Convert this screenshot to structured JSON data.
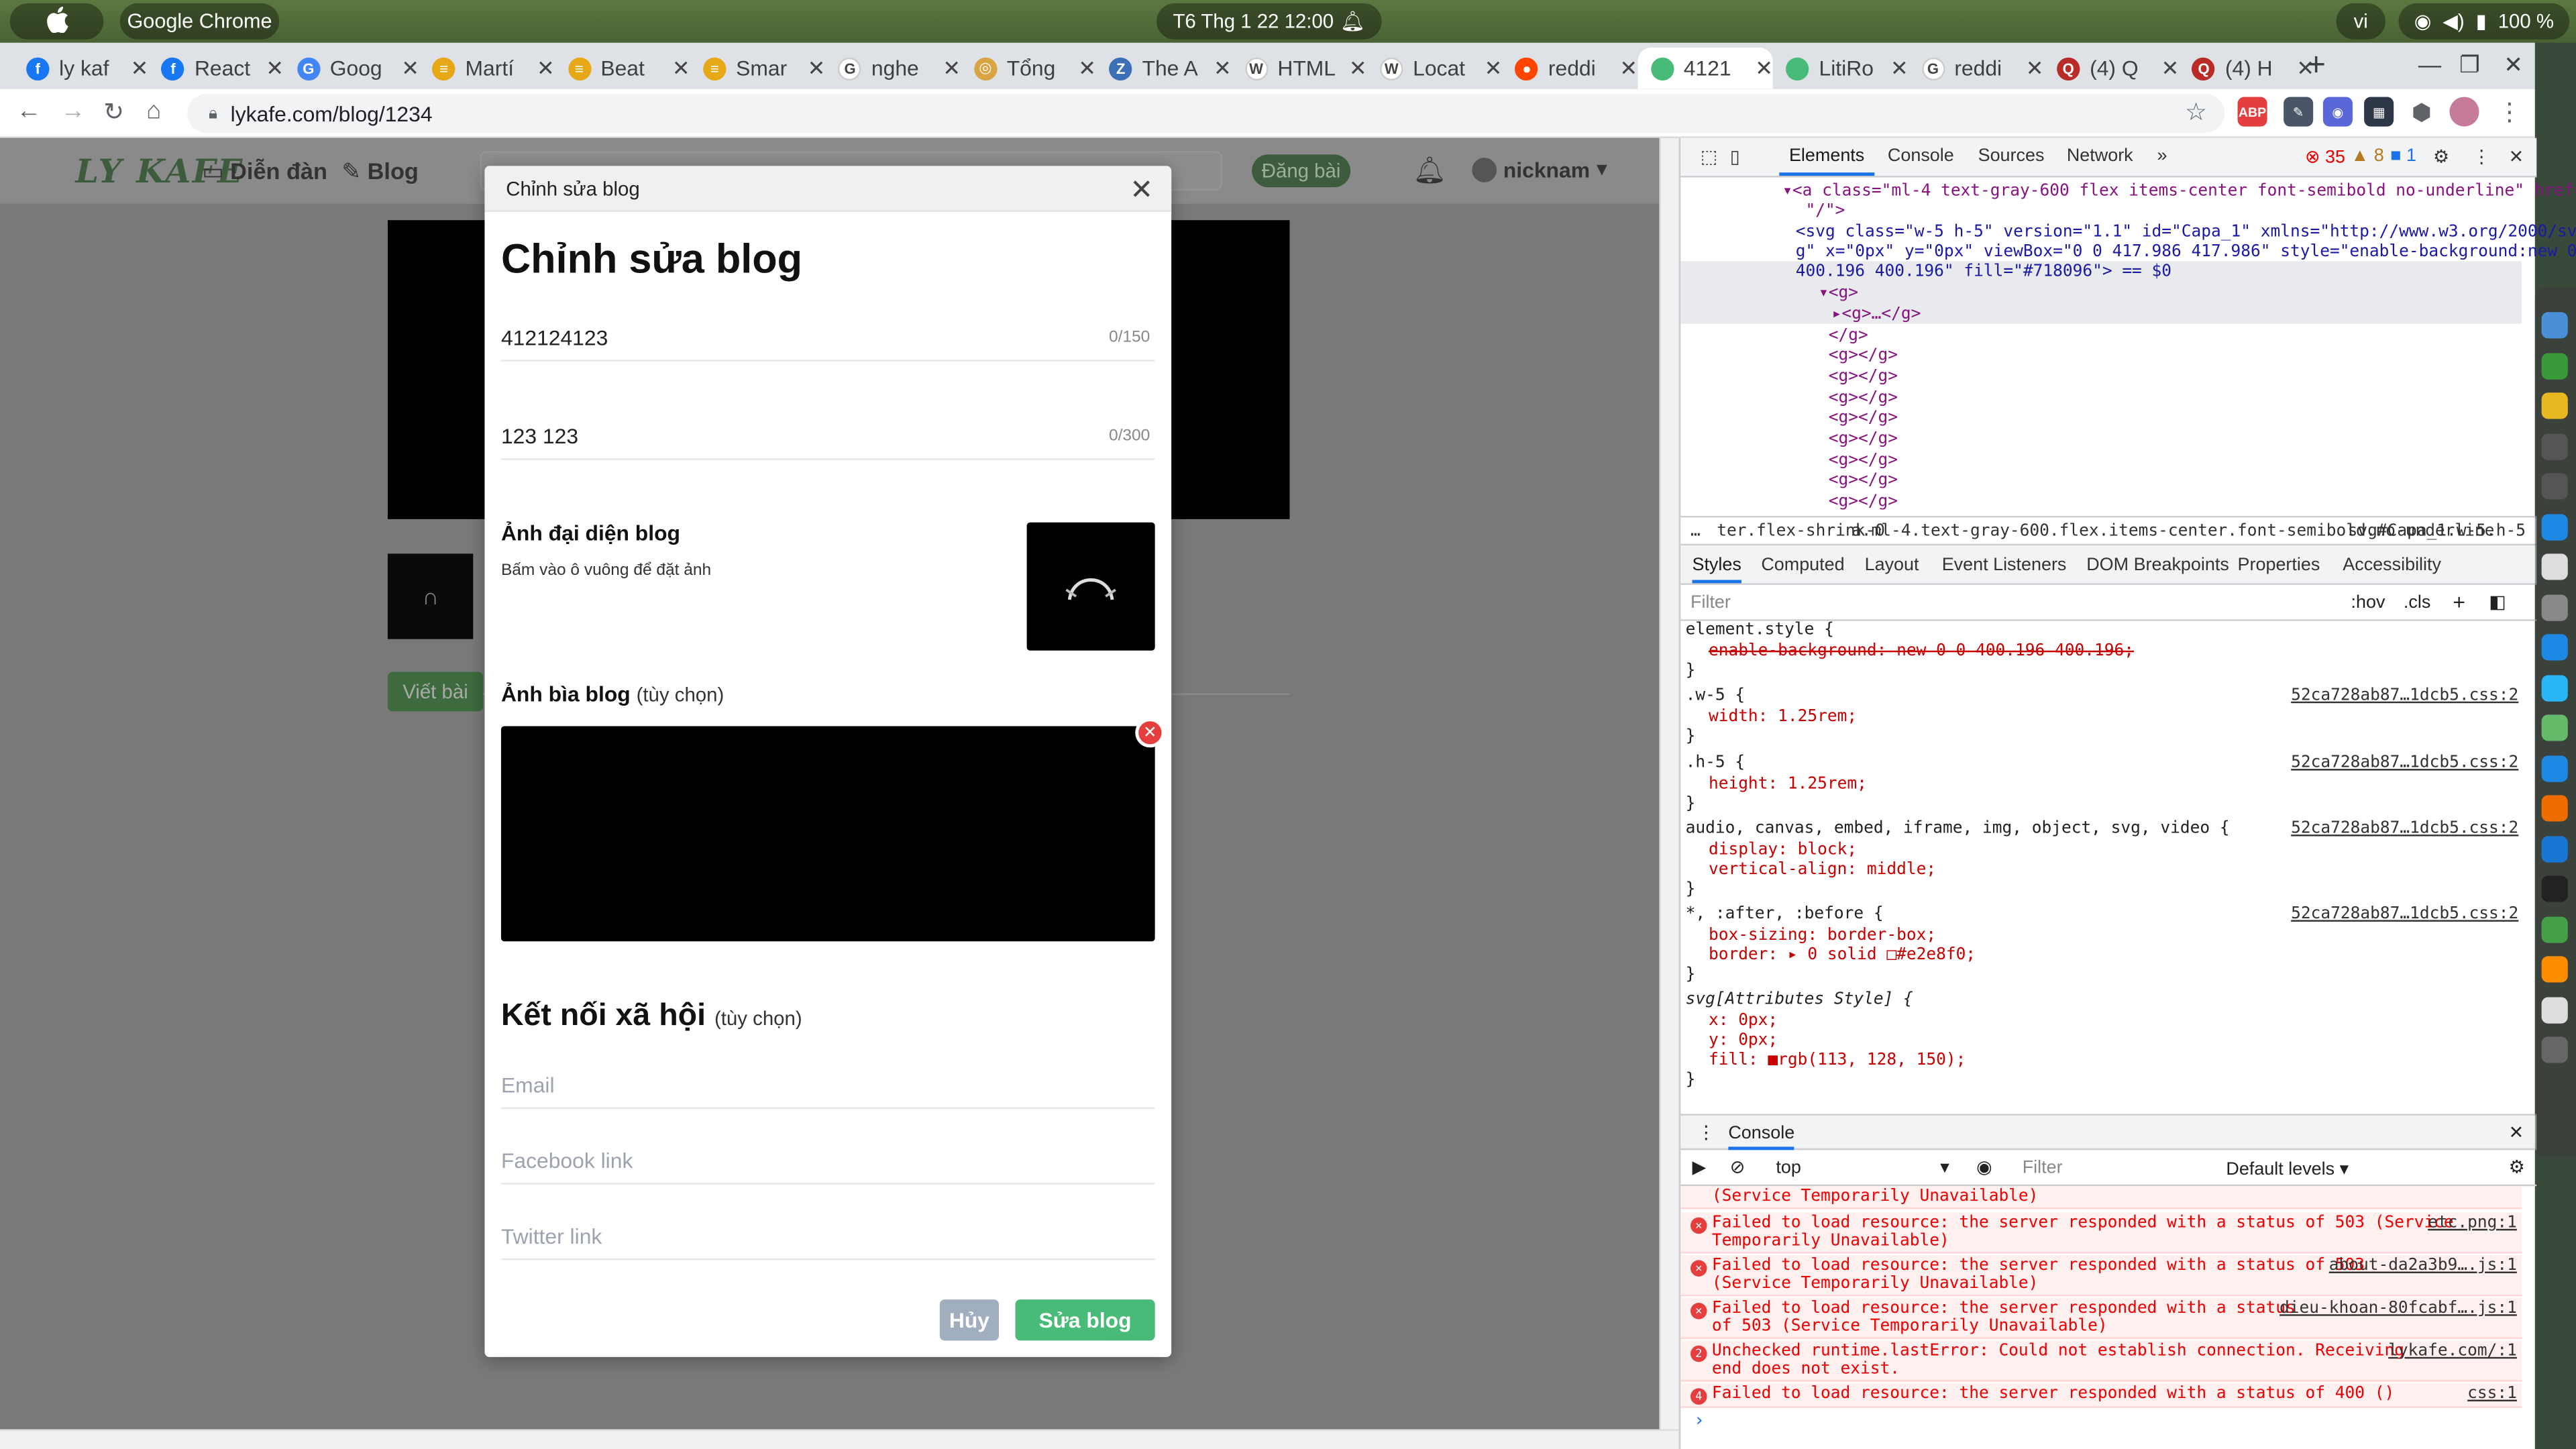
{
  "system": {
    "app_name": "Google Chrome",
    "clock": "T6 Thg 1 22  12:00",
    "language": "vi",
    "battery": "100 %"
  },
  "tabs": [
    {
      "title": "ly kaf",
      "color": "#1877f2",
      "glyph": "f"
    },
    {
      "title": "React",
      "color": "#1877f2",
      "glyph": "f"
    },
    {
      "title": "Goog",
      "color": "#4285f4",
      "glyph": "G"
    },
    {
      "title": "Martí",
      "color": "#e6a817",
      "glyph": "≡"
    },
    {
      "title": "Beat",
      "color": "#e6a817",
      "glyph": "≡"
    },
    {
      "title": "Smar",
      "color": "#e6a817",
      "glyph": "≡"
    },
    {
      "title": "nghe",
      "color": "#ffffff",
      "glyph": "G"
    },
    {
      "title": "Tổng",
      "color": "#d9a441",
      "glyph": "◎"
    },
    {
      "title": "The A",
      "color": "#3b6fb6",
      "glyph": "Z"
    },
    {
      "title": "HTML",
      "color": "#ffffff",
      "glyph": "W"
    },
    {
      "title": "Locat",
      "color": "#ffffff",
      "glyph": "W"
    },
    {
      "title": "reddi",
      "color": "#ff4500",
      "glyph": "●"
    },
    {
      "title": "4121",
      "color": "#48bb78",
      "glyph": ""
    },
    {
      "title": "LitiRo",
      "color": "#48bb78",
      "glyph": ""
    },
    {
      "title": "reddi",
      "color": "#ffffff",
      "glyph": "G"
    },
    {
      "title": "(4) Q",
      "color": "#b92b27",
      "glyph": "Q"
    },
    {
      "title": "(4) H",
      "color": "#b92b27",
      "glyph": "Q"
    }
  ],
  "address": {
    "url": "lykafe.com/blog/1234"
  },
  "site": {
    "logo": "LY KAFE",
    "nav_forum": "Diễn đàn",
    "nav_blog": "Blog",
    "post_button": "Đăng bài",
    "username": "nicknam",
    "write_button": "Viết bài"
  },
  "modal": {
    "header": "Chỉnh sửa blog",
    "title": "Chỉnh sửa blog",
    "title_value": "412124123",
    "title_count": "0/150",
    "desc_value": "123 123",
    "desc_count": "0/300",
    "avatar_label": "Ảnh đại diện blog",
    "avatar_hint": "Bấm vào ô vuông để đặt ảnh",
    "cover_label": "Ảnh bìa blog",
    "optional": "(tùy chọn)",
    "social_title": "Kết nối xã hội",
    "email_placeholder": "Email",
    "facebook_placeholder": "Facebook link",
    "twitter_placeholder": "Twitter link",
    "cancel": "Hủy",
    "save": "Sửa blog"
  },
  "devtools": {
    "tabs": [
      "Elements",
      "Console",
      "Sources",
      "Network"
    ],
    "error_count": "35",
    "warn_count": "8",
    "info_count": "1",
    "dom_lines": [
      "▾<a class=\"ml-4 text-gray-600 flex items-center font-semibold no-underline\" href=",
      "\"/\">",
      "<svg class=\"w-5 h-5\" version=\"1.1\" id=\"Capa_1\" xmlns=\"http://www.w3.org/2000/sv",
      "g\" x=\"0px\" y=\"0px\" viewBox=\"0 0 417.986 417.986\" style=\"enable-background:new 0 0",
      "400.196 400.196\" fill=\"#718096\"> == $0",
      "▾<g>",
      "▸<g>…</g>",
      "</g>",
      "<g></g>",
      "<g></g>",
      "<g></g>",
      "<g></g>",
      "<g></g>",
      "<g></g>",
      "<g></g>",
      "<g></g>"
    ],
    "breadcrumbs": [
      "ter.flex-shrink-0",
      "a.ml-4.text-gray-600.flex.items-center.font-semibold.no-underline",
      "svg#Capa_1.w-5.h-5"
    ],
    "sub_tabs": [
      "Styles",
      "Computed",
      "Layout",
      "Event Listeners",
      "DOM Breakpoints",
      "Properties",
      "Accessibility"
    ],
    "filter_placeholder": "Filter",
    "hov": ":hov",
    "cls": ".cls",
    "styles": [
      {
        "text": "element.style {",
        "kind": "sel"
      },
      {
        "text": "enable-background: new 0 0 400.196 400.196;",
        "kind": "strike"
      },
      {
        "text": "}",
        "kind": "sel"
      },
      {
        "text": ".w-5 {",
        "kind": "sel",
        "src": "52ca728ab87…1dcb5.css:2"
      },
      {
        "text": "width: 1.25rem;",
        "kind": "prop"
      },
      {
        "text": "}",
        "kind": "sel"
      },
      {
        "text": ".h-5 {",
        "kind": "sel",
        "src": "52ca728ab87…1dcb5.css:2"
      },
      {
        "text": "height: 1.25rem;",
        "kind": "prop"
      },
      {
        "text": "}",
        "kind": "sel"
      },
      {
        "text": "audio, canvas, embed, iframe, img, object, svg, video {",
        "kind": "sel",
        "src": "52ca728ab87…1dcb5.css:2"
      },
      {
        "text": "display: block;",
        "kind": "prop"
      },
      {
        "text": "vertical-align: middle;",
        "kind": "prop"
      },
      {
        "text": "}",
        "kind": "sel"
      },
      {
        "text": "*, :after, :before {",
        "kind": "sel",
        "src": "52ca728ab87…1dcb5.css:2"
      },
      {
        "text": "box-sizing: border-box;",
        "kind": "prop"
      },
      {
        "text": "border: ▸ 0 solid □#e2e8f0;",
        "kind": "prop"
      },
      {
        "text": "}",
        "kind": "sel"
      },
      {
        "text": "svg[Attributes Style] {",
        "kind": "attr"
      },
      {
        "text": "x: 0px;",
        "kind": "prop"
      },
      {
        "text": "y: 0px;",
        "kind": "prop"
      },
      {
        "text": "fill: ■rgb(113, 128, 150);",
        "kind": "prop"
      },
      {
        "text": "}",
        "kind": "sel"
      }
    ],
    "console_tab": "Console",
    "context": "top",
    "console_filter": "Filter",
    "levels": "Default levels ▾",
    "logs": [
      {
        "msg": "(Service Temporarily Unavailable)",
        "link": "",
        "badge": ""
      },
      {
        "msg": "Failed to load resource: the server responded with a status of 503 (Service\nTemporarily Unavailable)",
        "link": "etc.png:1",
        "badge": "x"
      },
      {
        "msg": "Failed to load resource: the server responded with a status of 503\n(Service Temporarily Unavailable)",
        "link": "about-da2a3b9….js:1",
        "badge": "x"
      },
      {
        "msg": "Failed to load resource: the server responded with a status\nof 503 (Service Temporarily Unavailable)",
        "link": "dieu-khoan-80fcabf….js:1",
        "badge": "x"
      },
      {
        "msg": "Unchecked runtime.lastError: Could not establish connection. Receiving\nend does not exist.",
        "link": "lykafe.com/:1",
        "badge": "2"
      },
      {
        "msg": "Failed to load resource: the server responded with a status of 400 ()",
        "link": "css:1",
        "badge": "4"
      }
    ]
  }
}
